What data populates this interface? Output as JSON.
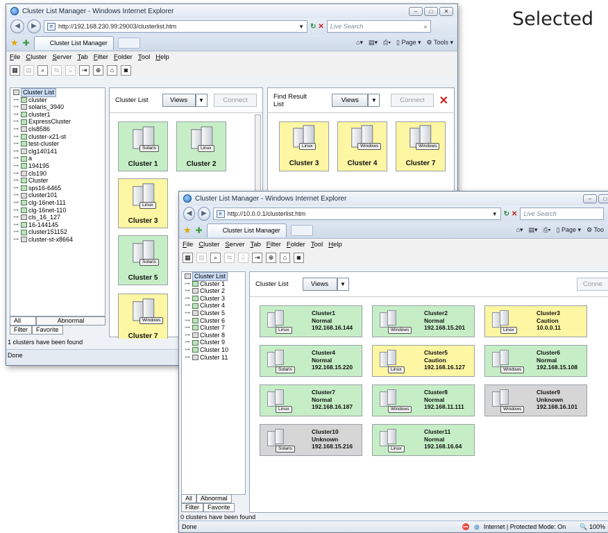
{
  "caption": "Selected",
  "window1": {
    "title": "Cluster List Manager - Windows Internet Explorer",
    "url": "http://192.168.230.99:29003/clusterlist.htm",
    "search_placeholder": "Live Search",
    "tab_label": "Cluster List Manager",
    "cmd_page": "Page",
    "cmd_tools": "Tools",
    "menu": [
      "File",
      "Cluster",
      "Server",
      "Tab",
      "Filter",
      "Folder",
      "Tool",
      "Help"
    ],
    "tree_root": "Cluster List",
    "tree": [
      "cluster",
      "solaris_3940",
      "cluster1",
      "ExpressCluster",
      "cls8586",
      "cluster-x21-st",
      "test-cluster",
      "clg140141",
      "a",
      "194195",
      "cls190",
      "Cluster",
      "sps16-6465",
      "cluster101",
      "clg-16net-111",
      "clg-16net-110",
      "cls_16_127",
      "16-144145",
      "cluster151152",
      "cluster-st-x8664"
    ],
    "tabs": {
      "all": "All",
      "abnormal": "Abnormal",
      "filter": "Filter",
      "favorite": "Favorite"
    },
    "status_count": "1 clusters have been found",
    "status_done": "Done",
    "left_panel": {
      "title": "Cluster List",
      "views": "Views",
      "connect": "Connect",
      "cards": [
        {
          "name": "Cluster 1",
          "os": "Solaris",
          "state": "normal"
        },
        {
          "name": "Cluster 2",
          "os": "Linux",
          "state": "normal"
        },
        {
          "name": "Cluster 3",
          "os": "Linux",
          "state": "caution"
        },
        {
          "name": "Cluster 5",
          "os": "Solaris",
          "state": "normal"
        },
        {
          "name": "Cluster 7",
          "os": "Windows",
          "state": "caution"
        }
      ]
    },
    "right_panel": {
      "title": "Find Result List",
      "views": "Views",
      "connect": "Connect",
      "cards": [
        {
          "name": "Cluster 3",
          "os": "Linux",
          "state": "caution"
        },
        {
          "name": "Cluster 4",
          "os": "Windows",
          "state": "caution"
        },
        {
          "name": "Cluster 7",
          "os": "Windows",
          "state": "caution"
        }
      ]
    }
  },
  "window2": {
    "title": "Cluster List Manager - Windows Internet Explorer",
    "url": "http://10.0.0.1/clusterlist.htm",
    "search_placeholder": "Live Search",
    "tab_label": "Cluster List Manager",
    "cmd_page": "Page",
    "cmd_tools": "Too",
    "menu": [
      "File",
      "Cluster",
      "Server",
      "Tab",
      "Filter",
      "Folder",
      "Tool",
      "Help"
    ],
    "tree_root": "Cluster List",
    "tree": [
      "Cluster 1",
      "Cluster 2",
      "Cluster 3",
      "Cluster 4",
      "Cluster 5",
      "Cluster 6",
      "Cluster 7",
      "Cluster 8",
      "Cluster 9",
      "Cluster 10",
      "Cluster 11"
    ],
    "tabs": {
      "all": "All",
      "abnormal": "Abnormal",
      "filter": "Filter",
      "favorite": "Favorite"
    },
    "panel": {
      "title": "Cluster List",
      "views": "Views",
      "connect": "Conne"
    },
    "status_count": "0 clusters have been found",
    "status_done": "Done",
    "status_zone": "Internet | Protected Mode: On",
    "zoom": "100%",
    "cards": [
      {
        "name": "Cluster1",
        "status": "Normal",
        "ip": "192.168.16.144",
        "os": "Linux",
        "state": "normal"
      },
      {
        "name": "Cluster2",
        "status": "Normal",
        "ip": "192.168.15.201",
        "os": "Windows",
        "state": "normal"
      },
      {
        "name": "Cluster3",
        "status": "Caution",
        "ip": "10.0.0.11",
        "os": "Linux",
        "state": "caution"
      },
      {
        "name": "Cluster4",
        "status": "Normal",
        "ip": "192.168.15.220",
        "os": "Solaris",
        "state": "normal"
      },
      {
        "name": "Cluster5",
        "status": "Caution",
        "ip": "192.168.16.127",
        "os": "Linux",
        "state": "caution"
      },
      {
        "name": "Cluster6",
        "status": "Normal",
        "ip": "192.168.15.108",
        "os": "Windows",
        "state": "normal"
      },
      {
        "name": "Cluster7",
        "status": "Normal",
        "ip": "192.168.16.187",
        "os": "Linux",
        "state": "normal"
      },
      {
        "name": "Cluster8",
        "status": "Normal",
        "ip": "192.168.11.111",
        "os": "Windows",
        "state": "normal"
      },
      {
        "name": "Cluster9",
        "status": "Unknown",
        "ip": "192.168.16.101",
        "os": "Windows",
        "state": "unknown"
      },
      {
        "name": "Cluster10",
        "status": "Unknown",
        "ip": "192.168.15.216",
        "os": "Solaris",
        "state": "unknown"
      },
      {
        "name": "Cluster11",
        "status": "Normal",
        "ip": "192.168.16.64",
        "os": "Linux",
        "state": "normal"
      }
    ]
  }
}
